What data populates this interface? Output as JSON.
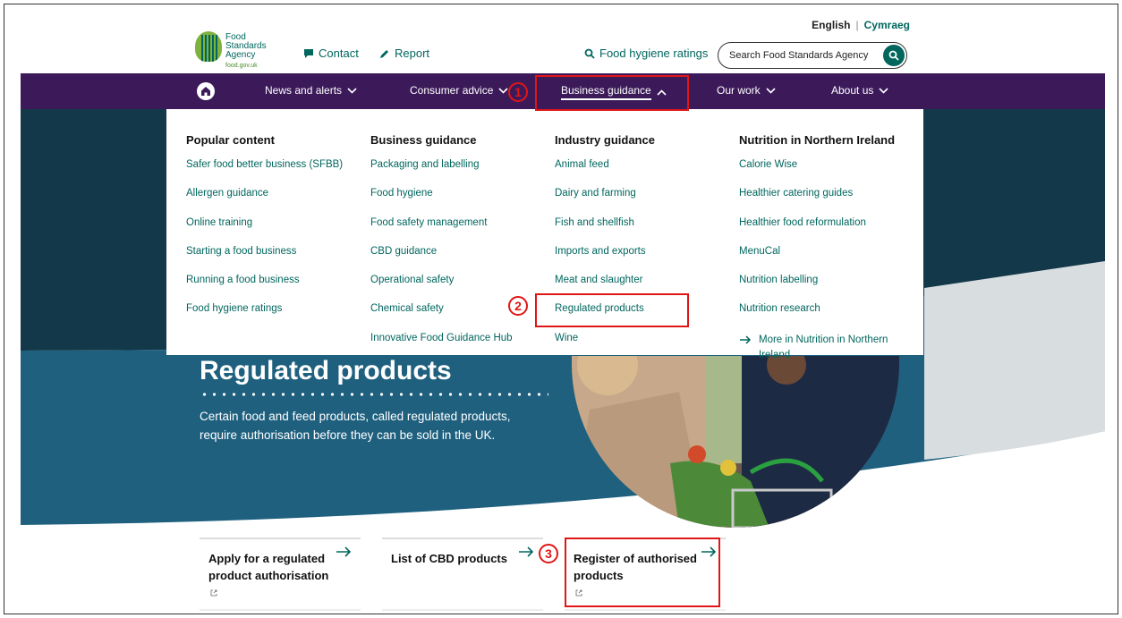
{
  "header": {
    "lang_english": "English",
    "lang_separator": "|",
    "lang_welsh": "Cymraeg",
    "logo_line1": "Food",
    "logo_line2": "Standards",
    "logo_line3": "Agency",
    "logo_url": "food.gov.uk",
    "contact": "Contact",
    "report": "Report",
    "hygiene_ratings": "Food hygiene ratings",
    "search_placeholder": "Search Food Standards Agency"
  },
  "nav": {
    "items": [
      {
        "label": "News and alerts"
      },
      {
        "label": "Consumer advice"
      },
      {
        "label": "Business guidance"
      },
      {
        "label": "Our work"
      },
      {
        "label": "About us"
      }
    ]
  },
  "annotations": {
    "step1": "1",
    "step2": "2",
    "step3": "3",
    "color": "#e01616"
  },
  "menu": {
    "columns": [
      {
        "heading": "Popular content",
        "links": [
          "Safer food better business (SFBB)",
          "Allergen guidance",
          "Online training",
          "Starting a food business",
          "Running a food business",
          "Food hygiene ratings"
        ]
      },
      {
        "heading": "Business guidance",
        "links": [
          "Packaging and labelling",
          "Food hygiene",
          "Food safety management",
          "CBD guidance",
          "Operational safety",
          "Chemical safety",
          "Innovative Food Guidance Hub"
        ]
      },
      {
        "heading": "Industry guidance",
        "links": [
          "Animal feed",
          "Dairy and farming",
          "Fish and shellfish",
          "Imports and exports",
          "Meat and slaughter",
          "Regulated products",
          "Wine"
        ]
      },
      {
        "heading": "Nutrition in Northern Ireland",
        "links": [
          "Calorie Wise",
          "Healthier catering guides",
          "Healthier food reformulation",
          "MenuCal",
          "Nutrition labelling",
          "Nutrition research"
        ],
        "more": "More in Nutrition in Northern Ireland"
      }
    ]
  },
  "hero": {
    "title": "Regulated products",
    "description": "Certain food and feed products, called regulated products, require authorisation before they can be sold in the UK."
  },
  "cards": [
    {
      "title": "Apply for a regulated product authorisation",
      "external": true
    },
    {
      "title": "List of CBD products",
      "external": false
    },
    {
      "title": "Register of authorised products",
      "external": true
    }
  ],
  "colors": {
    "brand_green": "#00665e",
    "nav_purple": "#3c1a5a",
    "hero_dark": "#13384a",
    "hero_blue": "#1f607f"
  }
}
